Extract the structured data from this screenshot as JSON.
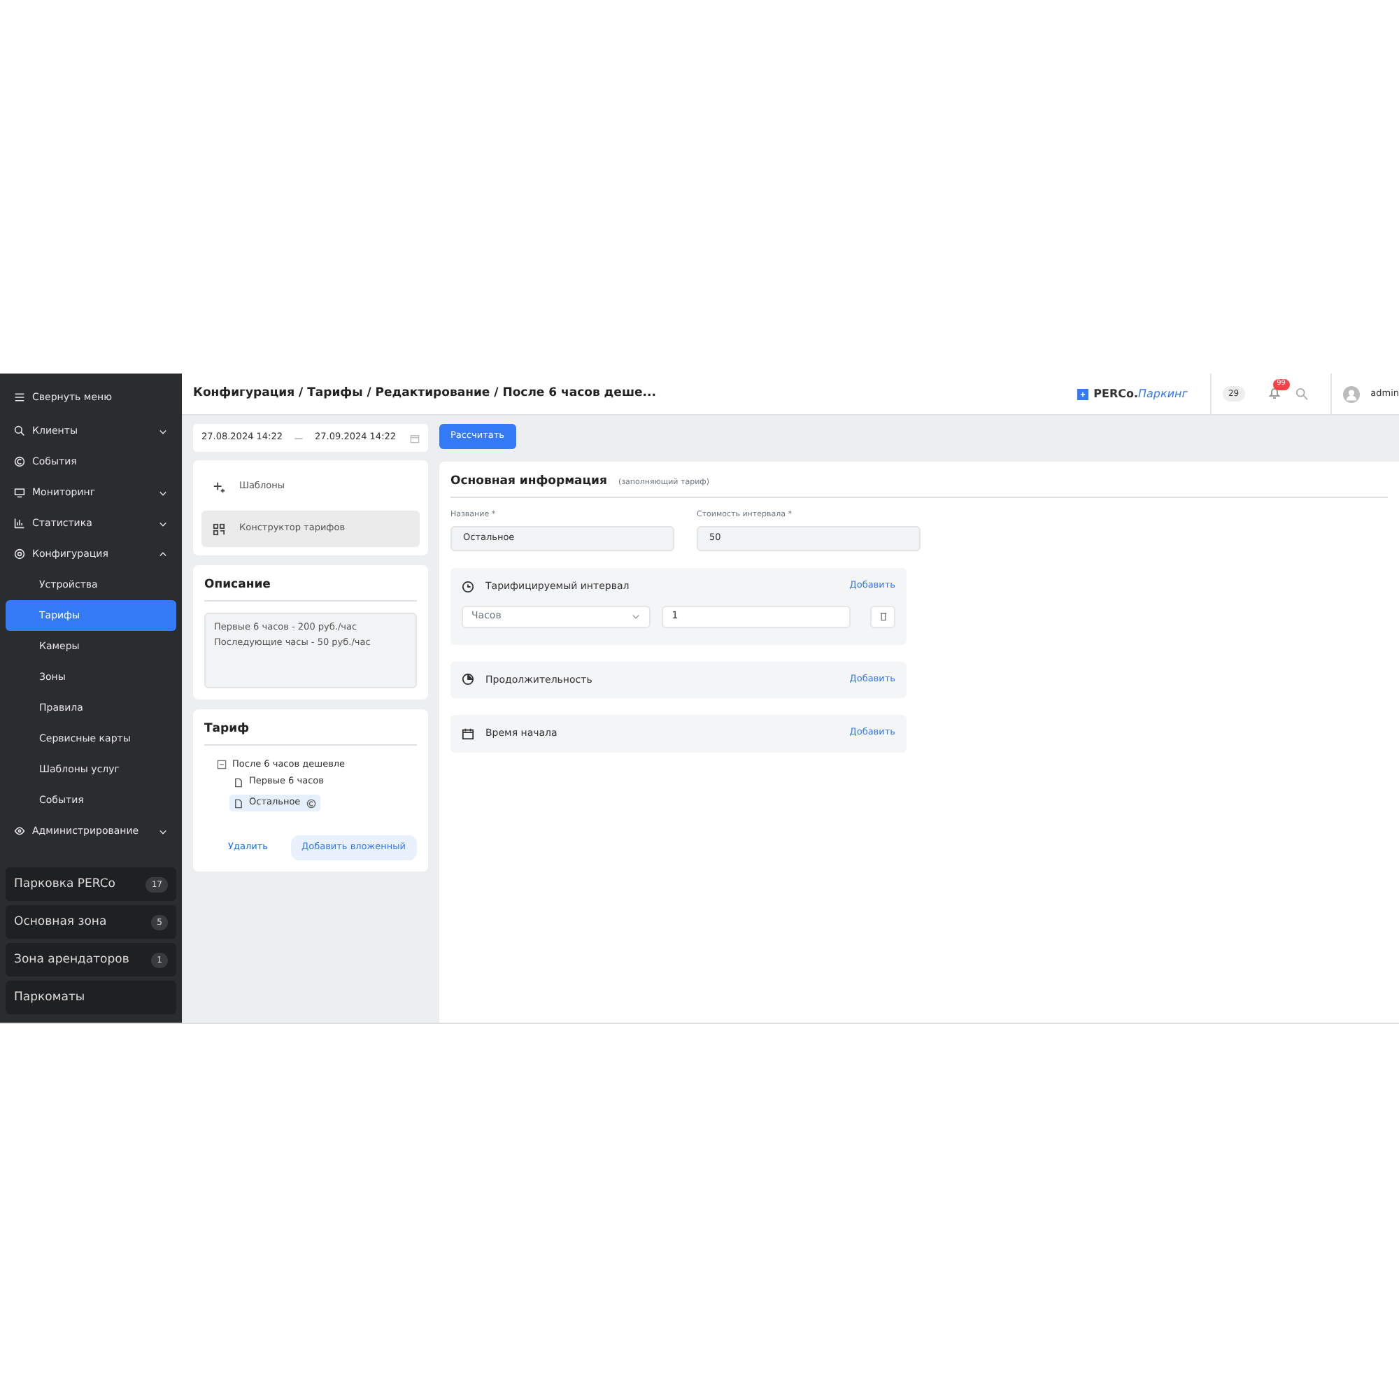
{
  "sidebar": {
    "collapse_label": "Свернуть меню",
    "items": [
      {
        "label": "Клиенты",
        "expanded": false
      },
      {
        "label": "События"
      },
      {
        "label": "Мониторинг",
        "expanded": false
      },
      {
        "label": "Статистика",
        "expanded": false
      },
      {
        "label": "Конфигурация",
        "expanded": true,
        "children": [
          {
            "label": "Устройства",
            "selected": false
          },
          {
            "label": "Тарифы",
            "selected": true
          },
          {
            "label": "Камеры",
            "selected": false
          },
          {
            "label": "Зоны",
            "selected": false
          },
          {
            "label": "Правила",
            "selected": false
          },
          {
            "label": "Сервисные карты",
            "selected": false
          },
          {
            "label": "Шаблоны услуг",
            "selected": false
          },
          {
            "label": "События",
            "selected": false
          }
        ]
      },
      {
        "label": "Администрирование",
        "expanded": false
      }
    ],
    "parkings": [
      {
        "name": "Парковка PERCo",
        "count": "17"
      },
      {
        "name": "Основная зона",
        "count": "5"
      },
      {
        "name": "Зона арендаторов",
        "count": "1"
      },
      {
        "name": "Паркоматы"
      }
    ]
  },
  "header": {
    "breadcrumb": "Конфигурация / Тарифы / Редактирование / После 6 часов деше...",
    "logo": {
      "brand": "PERCo.",
      "product": "Паркинг"
    },
    "counter": "29",
    "notifications": "99",
    "user": "admin"
  },
  "toolbar": {
    "date_from": "27.08.2024 14:22",
    "date_to": "27.09.2024 14:22",
    "calculate_button": "Рассчитать"
  },
  "modes": [
    {
      "label": "Шаблоны",
      "selected": false
    },
    {
      "label": "Конструктор тарифов",
      "selected": true
    }
  ],
  "description": {
    "title": "Описание",
    "lines": [
      "Первые 6 часов - 200 руб./час",
      "Последующие часы - 50 руб./час"
    ]
  },
  "tariff": {
    "title": "Тариф",
    "tree": [
      {
        "label": "После 6 часов дешевле",
        "expanded": true,
        "selected": false,
        "children": [
          {
            "label": "Первые 6 часов",
            "selected": false
          },
          {
            "label": "Остальное",
            "selected": true
          }
        ]
      }
    ],
    "delete_button": "Удалить",
    "add_button": "Добавить вложенный"
  },
  "main": {
    "title": "Основная информация",
    "subtitle": "(заполняющий тариф)",
    "fields": [
      {
        "label": "Название *",
        "value": "Остальное"
      },
      {
        "label": "Стоимость интервала *",
        "value": "50"
      }
    ],
    "sections": [
      {
        "title": "Тарифицируемый интервал",
        "action": "Добавить",
        "unit": "Часов",
        "amount": "1"
      },
      {
        "title": "Продолжительность",
        "action": "Добавить"
      },
      {
        "title": "Время начала",
        "action": "Добавить"
      }
    ]
  }
}
